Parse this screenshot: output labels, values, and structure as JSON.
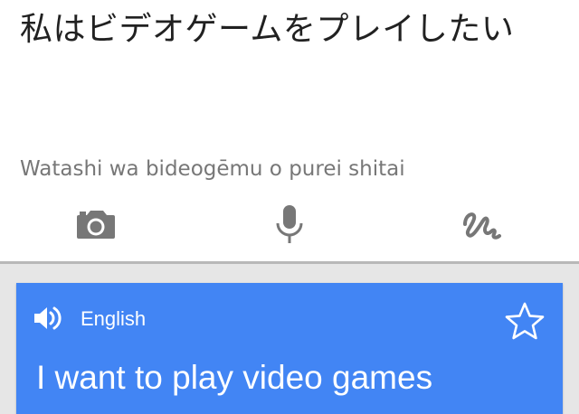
{
  "source": {
    "text": "私はビデオゲームをプレイしたい",
    "romanization": "Watashi wa bideogēmu o purei shitai"
  },
  "input_tools": [
    {
      "icon": "camera-icon"
    },
    {
      "icon": "microphone-icon"
    },
    {
      "icon": "handwriting-icon"
    }
  ],
  "result": {
    "language": "English",
    "translation": "I want to play video games",
    "speaker_icon": "speaker-icon",
    "favorite_icon": "star-outline-icon"
  },
  "colors": {
    "card_background": "#4285f4",
    "result_area_background": "#e6e6e6",
    "source_text": "#212121",
    "romanization_text": "#777777",
    "icon_gray": "#777777"
  }
}
